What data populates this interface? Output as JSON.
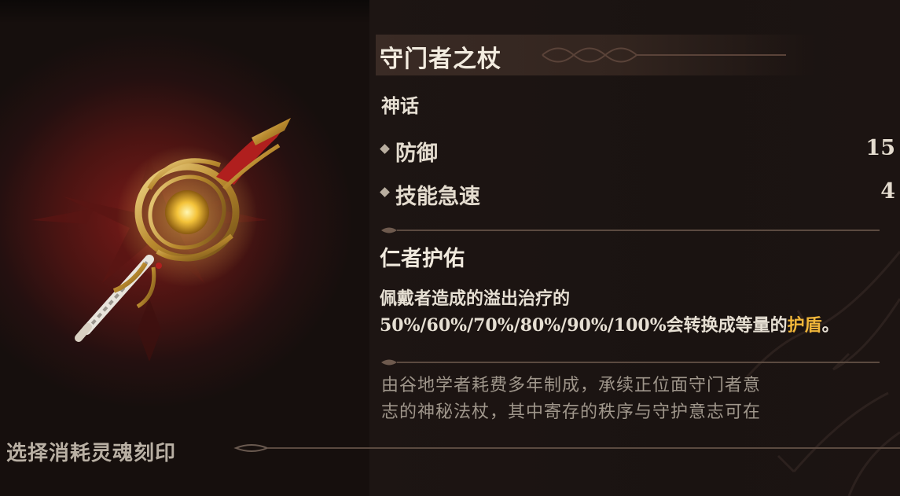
{
  "item": {
    "name": "守门者之杖",
    "rarity": "神话",
    "stats": [
      {
        "label": "防御",
        "value": "15"
      },
      {
        "label": "技能急速",
        "value": "4"
      }
    ],
    "passive": {
      "name": "仁者护佑",
      "desc_line1": "佩戴者造成的溢出治疗的",
      "desc_line2_prefix": "50%/60%/70%/80%/90%/100%会转换成等量的",
      "desc_highlight": "护盾",
      "desc_suffix": "。"
    },
    "lore_line1": "由谷地学者耗费多年制成，承续正位面守门者意",
    "lore_line2": "志的神秘法杖，其中寄存的秩序与守护意志可在"
  },
  "footer": {
    "label": "选择消耗灵魂刻印"
  },
  "icons": {
    "staff": "golden-orb-staff-icon",
    "sigil": "crimson-sigil-background"
  },
  "colors": {
    "highlight": "#f0b63a",
    "art_glow": "#7a1a18",
    "panel_bg": "#1a1311"
  }
}
